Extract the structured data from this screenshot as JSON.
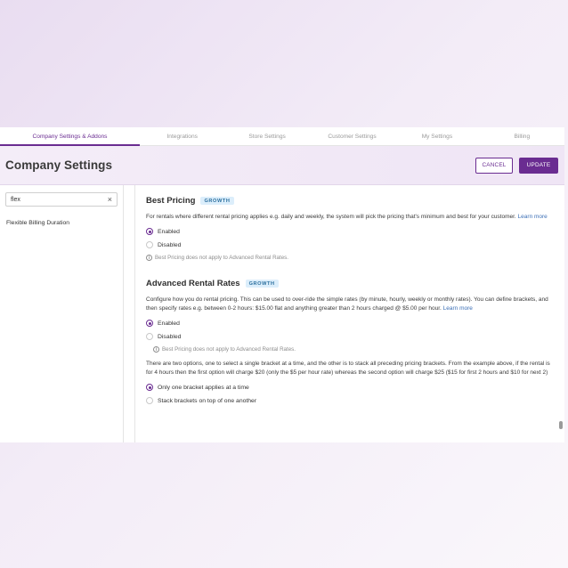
{
  "tabs": [
    {
      "label": "Company Settings & Addons",
      "active": true
    },
    {
      "label": "Integrations",
      "active": false
    },
    {
      "label": "Store Settings",
      "active": false
    },
    {
      "label": "Customer Settings",
      "active": false
    },
    {
      "label": "My Settings",
      "active": false
    },
    {
      "label": "Billing",
      "active": false
    }
  ],
  "header": {
    "title": "Company Settings",
    "cancel_label": "CANCEL",
    "update_label": "UPDATE"
  },
  "sidebar": {
    "search_value": "flex",
    "clear_icon": "×",
    "results": [
      "Flexible Billing Duration"
    ]
  },
  "sections": {
    "best_pricing": {
      "title": "Best Pricing",
      "badge": "GROWTH",
      "desc": "For rentals where different rental pricing applies e.g. daily and weekly, the system will pick the pricing that's minimum and best for your customer.",
      "link": "Learn more",
      "options": [
        "Enabled",
        "Disabled"
      ],
      "selected": "Enabled",
      "note": "Best Pricing does not apply to Advanced Rental Rates."
    },
    "advanced_rates": {
      "title": "Advanced Rental Rates",
      "badge": "GROWTH",
      "desc": "Configure how you do rental pricing. This can be used to over-ride the simple rates (by minute, hourly, weekly or monthly rates). You can define brackets, and then specify rates e.g. between 0-2 hours: $15.00 flat and anything greater than 2 hours charged @ $5.00 per hour.",
      "link": "Learn more",
      "options": [
        "Enabled",
        "Disabled"
      ],
      "selected": "Enabled",
      "note": "Best Pricing does not apply to Advanced Rental Rates.",
      "bracket_desc": "There are two options, one to select a single bracket at a time, and the other is to stack all preceding pricing brackets. From the example above, if the rental is for 4 hours then the first option will charge $20 (only the $5 per hour rate) whereas the second option will charge $25 ($15 for first 2 hours and $10 for next 2)",
      "bracket_options": [
        "Only one bracket applies at a time",
        "Stack brackets on top of one another"
      ],
      "bracket_selected": "Only one bracket applies at a time"
    }
  },
  "colors": {
    "accent": "#6a2c91",
    "badge_bg": "#dceefb",
    "badge_text": "#2b6f9e",
    "link": "#3b6fb6"
  }
}
